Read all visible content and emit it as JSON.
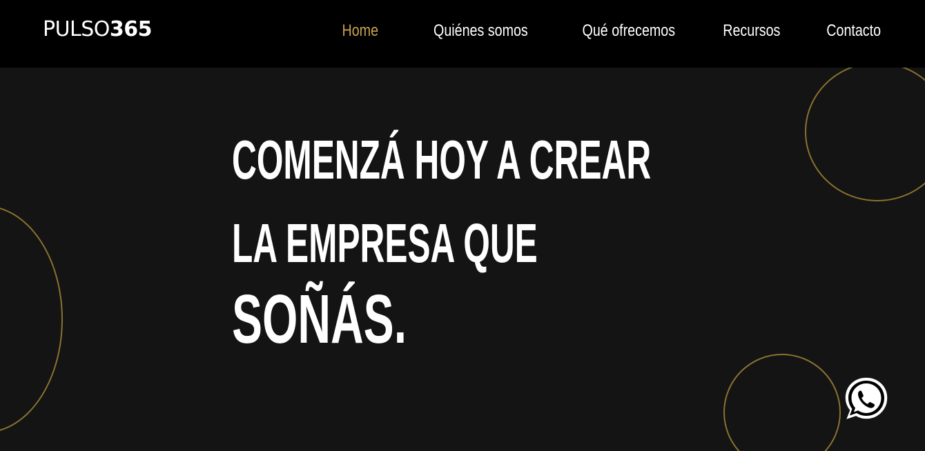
{
  "logo": {
    "part1": "PULSO",
    "part2": "365"
  },
  "nav": {
    "items": [
      {
        "label": "Home",
        "active": true
      },
      {
        "label": "Quiénes somos"
      },
      {
        "label": "Qué ofrecemos"
      },
      {
        "label": "Recursos"
      },
      {
        "label": "Contacto"
      }
    ]
  },
  "hero": {
    "line1": "COMENZÁ HOY A CREAR",
    "line2": "LA EMPRESA QUE",
    "line3": "SOÑÁS."
  },
  "whatsapp": {
    "icon": "whatsapp-icon"
  },
  "colors": {
    "accent": "#c9a24d",
    "background": "#141414",
    "navbar": "#000000",
    "text": "#ffffff"
  }
}
